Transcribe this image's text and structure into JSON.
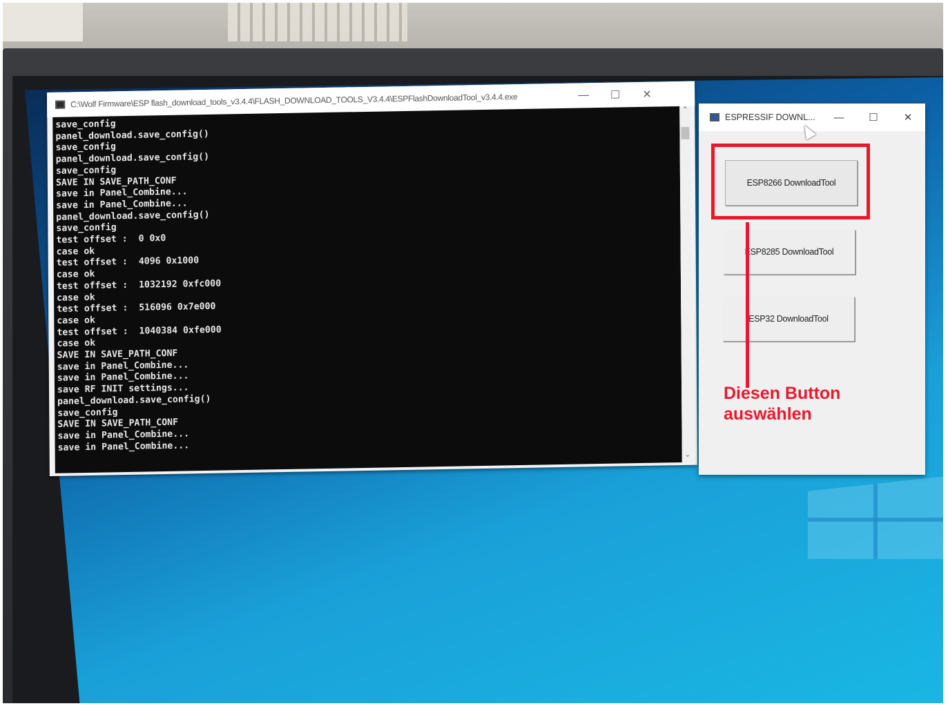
{
  "console_window": {
    "title": "C:\\Wolf Firmware\\ESP flash_download_tools_v3.4.4\\FLASH_DOWNLOAD_TOOLS_V3.4.4\\ESPFlashDownloadTool_v3.4.4.exe",
    "minimize": "—",
    "maximize": "☐",
    "close": "✕",
    "log_lines": [
      "save_config",
      "panel_download.save_config()",
      "save_config",
      "panel_download.save_config()",
      "save_config",
      "SAVE IN SAVE_PATH_CONF",
      "save in Panel_Combine...",
      "save in Panel_Combine...",
      "panel_download.save_config()",
      "save_config",
      "test offset :  0 0x0",
      "case ok",
      "test offset :  4096 0x1000",
      "case ok",
      "test offset :  1032192 0xfc000",
      "case ok",
      "test offset :  516096 0x7e000",
      "case ok",
      "test offset :  1040384 0xfe000",
      "case ok",
      "SAVE IN SAVE_PATH_CONF",
      "save in Panel_Combine...",
      "save in Panel_Combine...",
      "save RF INIT settings...",
      "panel_download.save_config()",
      "save_config",
      "SAVE IN SAVE_PATH_CONF",
      "save in Panel_Combine...",
      "save in Panel_Combine..."
    ],
    "scroll_up": "⌃",
    "scroll_down": "⌄"
  },
  "esp_window": {
    "title": "ESPRESSIF DOWNL...",
    "minimize": "—",
    "maximize": "☐",
    "close": "✕",
    "buttons": [
      {
        "label": "ESP8266 DownloadTool"
      },
      {
        "label": "ESP8285 DownloadTool"
      },
      {
        "label": "ESP32 DownloadTool"
      }
    ]
  },
  "annotation": {
    "line1": "Diesen Button",
    "line2": "auswählen",
    "color": "#e8192c"
  }
}
